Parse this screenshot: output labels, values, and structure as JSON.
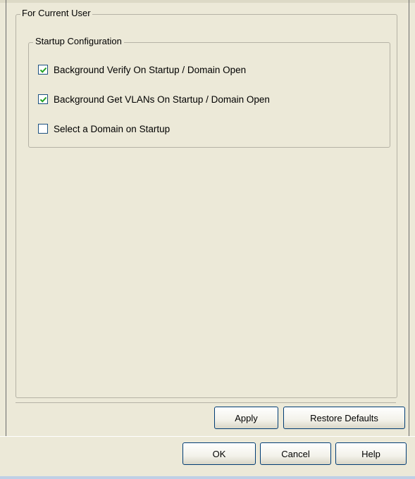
{
  "outer_group": {
    "legend": "For Current User"
  },
  "startup": {
    "legend": "Startup Configuration",
    "options": [
      {
        "label": "Background Verify On Startup / Domain Open",
        "checked": true
      },
      {
        "label": "Background Get VLANs On Startup / Domain Open",
        "checked": true
      },
      {
        "label": "Select a Domain on Startup",
        "checked": false
      }
    ]
  },
  "buttons": {
    "apply": "Apply",
    "restore_defaults": "Restore Defaults",
    "ok": "OK",
    "cancel": "Cancel",
    "help": "Help"
  },
  "colors": {
    "background": "#ece9d8",
    "group_border": "#b5b2a5",
    "checkbox_border": "#1c5180",
    "check_mark": "#21a121",
    "button_border": "#003c74"
  }
}
